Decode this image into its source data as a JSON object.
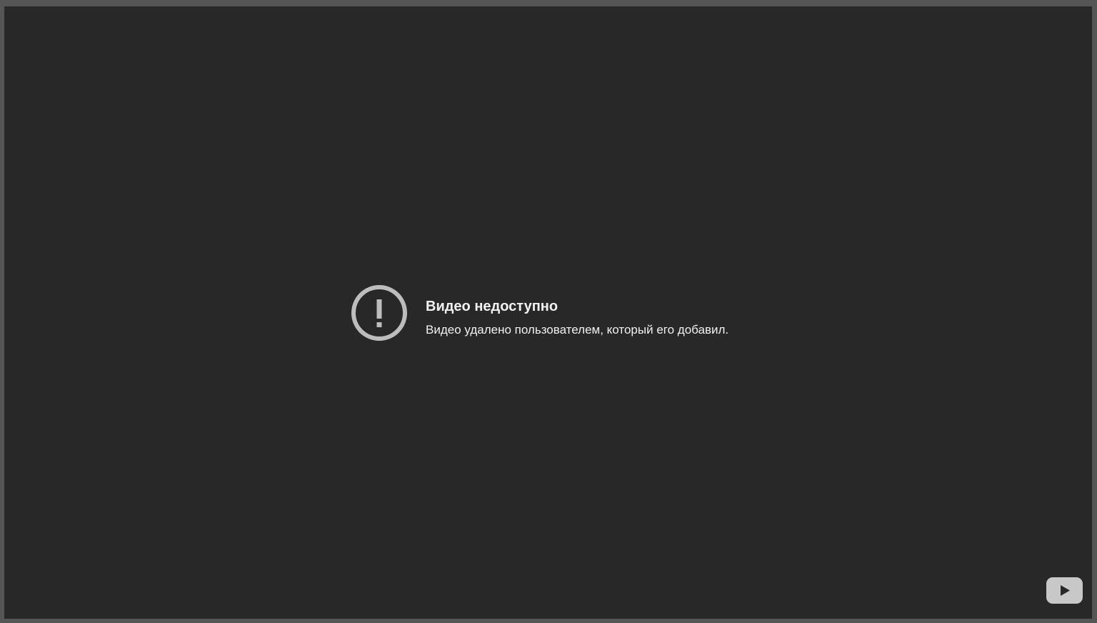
{
  "error": {
    "icon": "exclamation-circle-icon",
    "title": "Видео недоступно",
    "subtitle": "Видео удалено пользователем, который его добавил."
  },
  "branding": {
    "logo_icon": "youtube-logo-icon"
  },
  "colors": {
    "player_background": "#282828",
    "frame_border": "#555555",
    "icon_gray": "#bdbdbd",
    "text": "#f1f1f1"
  }
}
